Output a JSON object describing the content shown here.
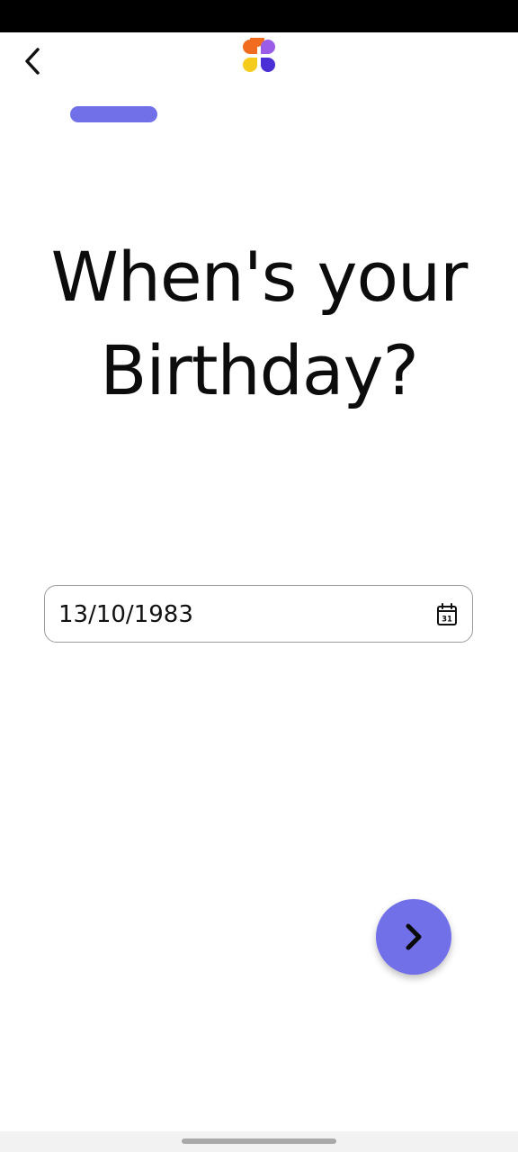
{
  "header": {
    "back_icon": "chevron-left-icon",
    "logo_icon": "four-petal-logo-icon"
  },
  "progress": {
    "fraction": 0.46
  },
  "question": {
    "line1": "When's your",
    "line2": "Birthday?"
  },
  "birthday_field": {
    "value": "13/10/1983",
    "calendar_icon": "calendar-icon",
    "calendar_day": "31"
  },
  "next_button": {
    "icon": "chevron-right-icon"
  },
  "colors": {
    "accent": "#7170e8",
    "logo_orange": "#f26c1f",
    "logo_purple": "#9b5ce8",
    "logo_yellow": "#f5cc1b",
    "logo_indigo": "#4a2fd6"
  }
}
